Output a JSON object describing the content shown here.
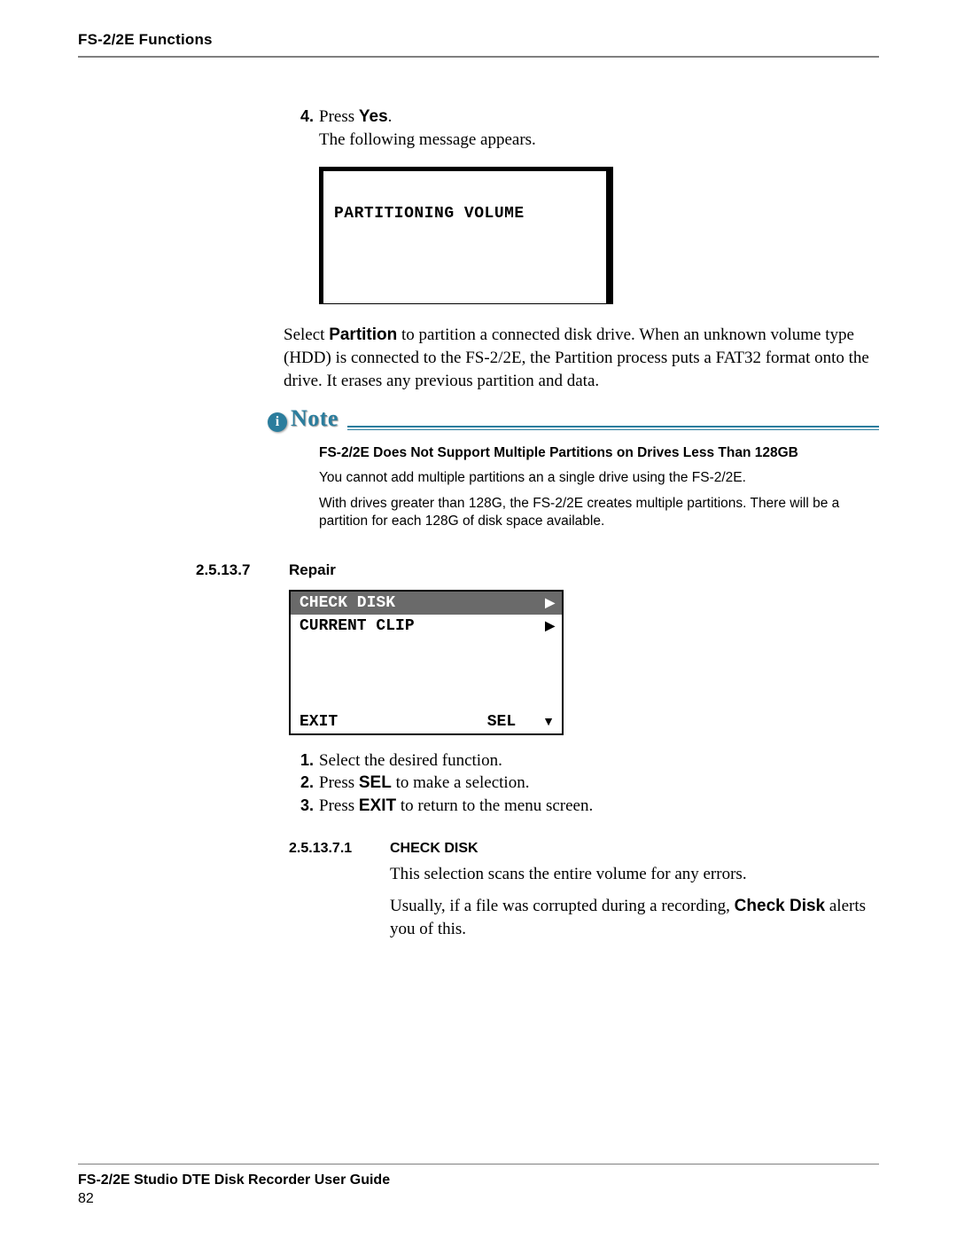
{
  "header": {
    "section_title": "FS-2/2E Functions"
  },
  "step4": {
    "number": "4.",
    "text_prefix": "Press ",
    "text_bold": "Yes",
    "text_suffix": ".",
    "following": "The following message appears."
  },
  "lcd1": {
    "line1": "PARTITIONING VOLUME"
  },
  "partition_para_prefix": "Select ",
  "partition_para_bold": "Partition",
  "partition_para_suffix": " to partition a connected disk drive. When an unknown volume type (HDD) is connected to the FS-2/2E, the Partition process puts a FAT32 format onto the drive. It erases any previous partition and data.",
  "note": {
    "label": "Note",
    "heading": "FS-2/2E Does Not Support Multiple Partitions on Drives Less Than 128GB",
    "p1": "You cannot add multiple partitions an a single drive using the FS-2/2E.",
    "p2": "With drives greater than 128G, the FS-2/2E creates multiple partitions. There will be a partition for each 128G of disk space available."
  },
  "repair": {
    "num": "2.5.13.7",
    "title": "Repair",
    "menu": {
      "row1_left": "CHECK DISK",
      "row1_arrow": "▶",
      "row2_left": "CURRENT CLIP",
      "row2_arrow": "▶",
      "footer_left": "EXIT",
      "footer_mid": "SEL",
      "footer_arrow": "▼"
    },
    "steps": {
      "s1_num": "1.",
      "s1_text": "Select the desired function.",
      "s2_num": "2.",
      "s2_prefix": "Press ",
      "s2_bold": "SEL",
      "s2_suffix": " to make a selection.",
      "s3_num": "3.",
      "s3_prefix": "Press ",
      "s3_bold": "EXIT",
      "s3_suffix": " to return to the menu screen."
    }
  },
  "checkdisk": {
    "num": "2.5.13.7.1",
    "title": "CHECK DISK",
    "p1": "This selection scans the entire volume for any errors.",
    "p2_prefix": "Usually, if a file was corrupted during a recording, ",
    "p2_bold": "Check Disk",
    "p2_suffix": " alerts you of this."
  },
  "footer": {
    "title": "FS-2/2E Studio DTE Disk Recorder User Guide",
    "page": "82"
  }
}
